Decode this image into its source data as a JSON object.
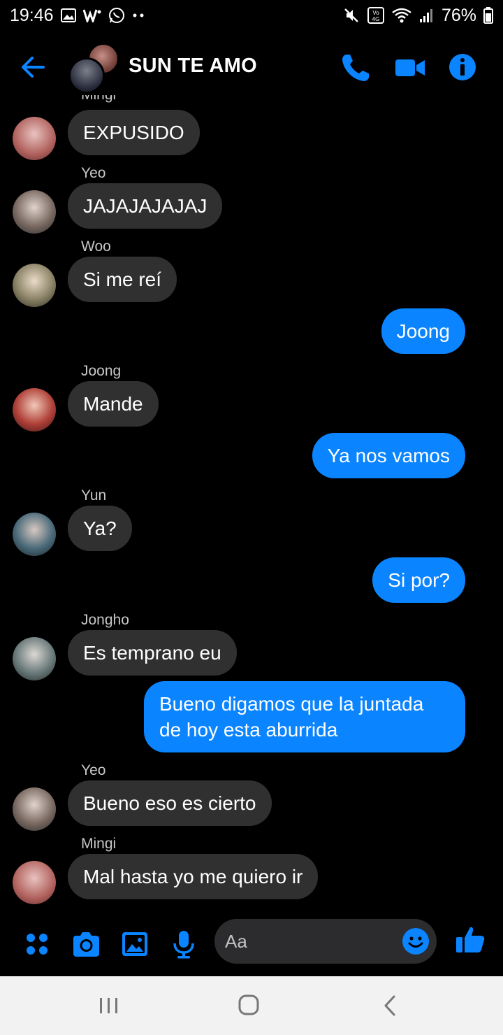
{
  "status_bar": {
    "time": "19:46",
    "battery": "76%"
  },
  "header": {
    "title": "SUN TE AMO"
  },
  "partial_sender": "Mingi",
  "messages": [
    {
      "side": "in",
      "sender": "",
      "text": "EXPUSIDO",
      "avatar_color": "#b05a5a"
    },
    {
      "side": "in",
      "sender": "Yeo",
      "text": "JAJAJAJAJAJ",
      "avatar_color": "#6a6a6a"
    },
    {
      "side": "in",
      "sender": "Woo",
      "text": "Si me reí",
      "avatar_color": "#8a8a6a"
    },
    {
      "side": "out",
      "text": "Joong"
    },
    {
      "side": "in",
      "sender": "Joong",
      "text": "Mande",
      "avatar_color": "#a0403a"
    },
    {
      "side": "out",
      "text": "Ya nos vamos"
    },
    {
      "side": "in",
      "sender": "Yun",
      "text": "Ya?",
      "avatar_color": "#4a6a7a"
    },
    {
      "side": "out",
      "text": "Si por?"
    },
    {
      "side": "in",
      "sender": "Jongho",
      "text": "Es temprano eu",
      "avatar_color": "#6a7a7a"
    },
    {
      "side": "out",
      "text": "Bueno digamos que la juntada de hoy esta aburrida"
    },
    {
      "side": "in",
      "sender": "Yeo",
      "text": "Bueno eso es cierto",
      "avatar_color": "#6a6a6a"
    },
    {
      "side": "in",
      "sender": "Mingi",
      "text": "Mal hasta yo me quiero ir",
      "avatar_color": "#b05a5a"
    }
  ],
  "composer": {
    "placeholder": "Aa"
  },
  "colors": {
    "accent": "#0a84ff",
    "incoming_bubble": "#303030",
    "background": "#000000"
  },
  "icons": [
    "back-arrow-icon",
    "phone-icon",
    "video-icon",
    "info-icon",
    "apps-icon",
    "camera-icon",
    "gallery-icon",
    "microphone-icon",
    "emoji-icon",
    "like-icon"
  ]
}
